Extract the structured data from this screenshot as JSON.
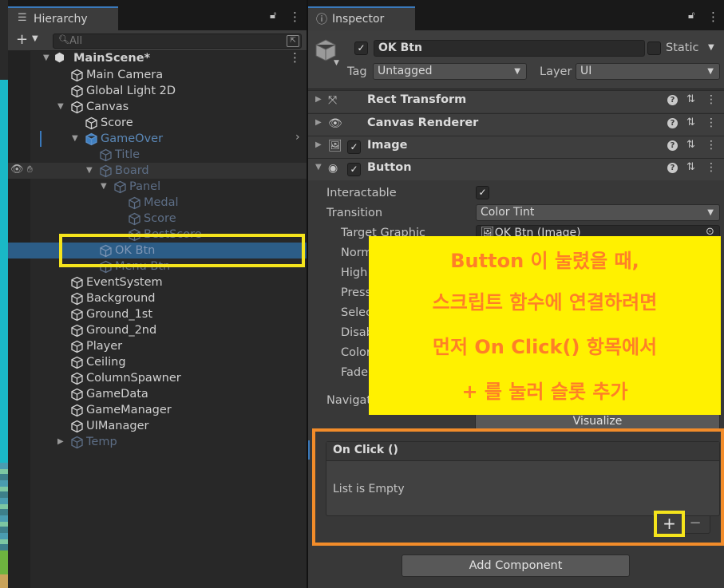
{
  "hierarchy": {
    "tab_label": "Hierarchy",
    "search_placeholder": "All",
    "scene": "MainScene*",
    "items": [
      {
        "label": "Main Camera"
      },
      {
        "label": "Global Light 2D"
      },
      {
        "label": "Canvas"
      },
      {
        "label": "Score"
      },
      {
        "label": "GameOver"
      },
      {
        "label": "Title"
      },
      {
        "label": "Board"
      },
      {
        "label": "Panel"
      },
      {
        "label": "Medal"
      },
      {
        "label": "Score"
      },
      {
        "label": "BestScore"
      },
      {
        "label": "OK Btn"
      },
      {
        "label": "Menu Btn"
      },
      {
        "label": "EventSystem"
      },
      {
        "label": "Background"
      },
      {
        "label": "Ground_1st"
      },
      {
        "label": "Ground_2nd"
      },
      {
        "label": "Player"
      },
      {
        "label": "Ceiling"
      },
      {
        "label": "ColumnSpawner"
      },
      {
        "label": "GameData"
      },
      {
        "label": "GameManager"
      },
      {
        "label": "UIManager"
      },
      {
        "label": "Temp"
      }
    ]
  },
  "inspector": {
    "tab_label": "Inspector",
    "object_name": "OK Btn",
    "static_label": "Static",
    "tag_label": "Tag",
    "tag_value": "Untagged",
    "layer_label": "Layer",
    "layer_value": "UI",
    "components": [
      {
        "name": "Rect Transform"
      },
      {
        "name": "Canvas Renderer"
      },
      {
        "name": "Image"
      },
      {
        "name": "Button"
      }
    ],
    "button": {
      "interactable_label": "Interactable",
      "transition_label": "Transition",
      "transition_value": "Color Tint",
      "target_graphic_label": "Target Graphic",
      "target_graphic_value": "OK Btn (Image)",
      "normal_label": "Norm",
      "highlighted_label": "High",
      "pressed_label": "Press",
      "selected_label": "Selec",
      "disabled_label": "Disab",
      "color_mult_label": "Color",
      "fade_label": "Fade",
      "navigation_label": "Navigat",
      "visualize_label": "Visualize"
    },
    "on_click": {
      "header": "On Click ()",
      "empty_text": "List is Empty",
      "plus": "+",
      "minus": "−"
    },
    "add_component": "Add Component"
  },
  "annotation": {
    "line1": "Button 이 눌렸을 때,",
    "line2": "스크립트 함수에 연결하려면",
    "line3": "먼저 On Click() 항목에서",
    "line4": "+ 를 눌러 슬롯 추가",
    "text_color": "#ff7f27",
    "bg_color": "#fff100",
    "frame_color": "#f28c2a",
    "highlight_color": "#f5e41c"
  }
}
